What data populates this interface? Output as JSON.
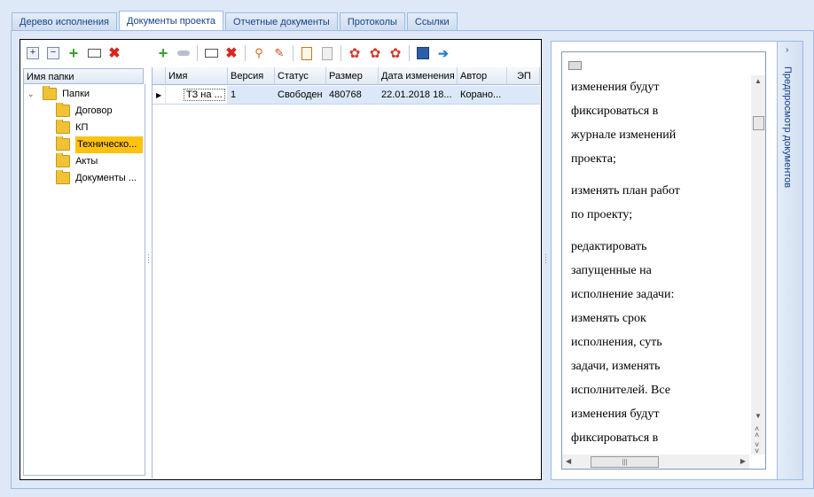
{
  "tabs": [
    "Дерево исполнения",
    "Документы проекта",
    "Отчетные документы",
    "Протоколы",
    "Ссылки"
  ],
  "active_tab": 1,
  "tree": {
    "header": "Имя папки",
    "root": "Папки",
    "folders": [
      "Договор",
      "КП",
      "Техническо...",
      "Акты",
      "Документы ..."
    ],
    "selected_index": 2
  },
  "grid": {
    "columns": [
      "Имя",
      "Версия",
      "Статус",
      "Размер",
      "Дата изменения",
      "Автор",
      "ЭП"
    ],
    "rows": [
      [
        "ТЗ на ...",
        "1",
        "Свободен",
        "480768",
        "22.01.2018 18...",
        "Корано...",
        ""
      ]
    ]
  },
  "preview": {
    "side_label": "Предпросмотр документов",
    "paragraphs": [
      [
        "изменения будут",
        "фиксироваться в",
        "журнале изменений",
        "проекта;"
      ],
      [
        "изменять план работ",
        "по проекту;"
      ],
      [
        "редактировать",
        "запущенные на",
        "исполнение задачи:",
        "изменять срок",
        "исполнения, суть",
        "задачи, изменять",
        "исполнителей. Все",
        "изменения будут",
        "фиксироваться в"
      ]
    ]
  },
  "colors": {
    "accent": "#15428b",
    "selected": "#ffc20e",
    "background": "#dfe8f6"
  }
}
